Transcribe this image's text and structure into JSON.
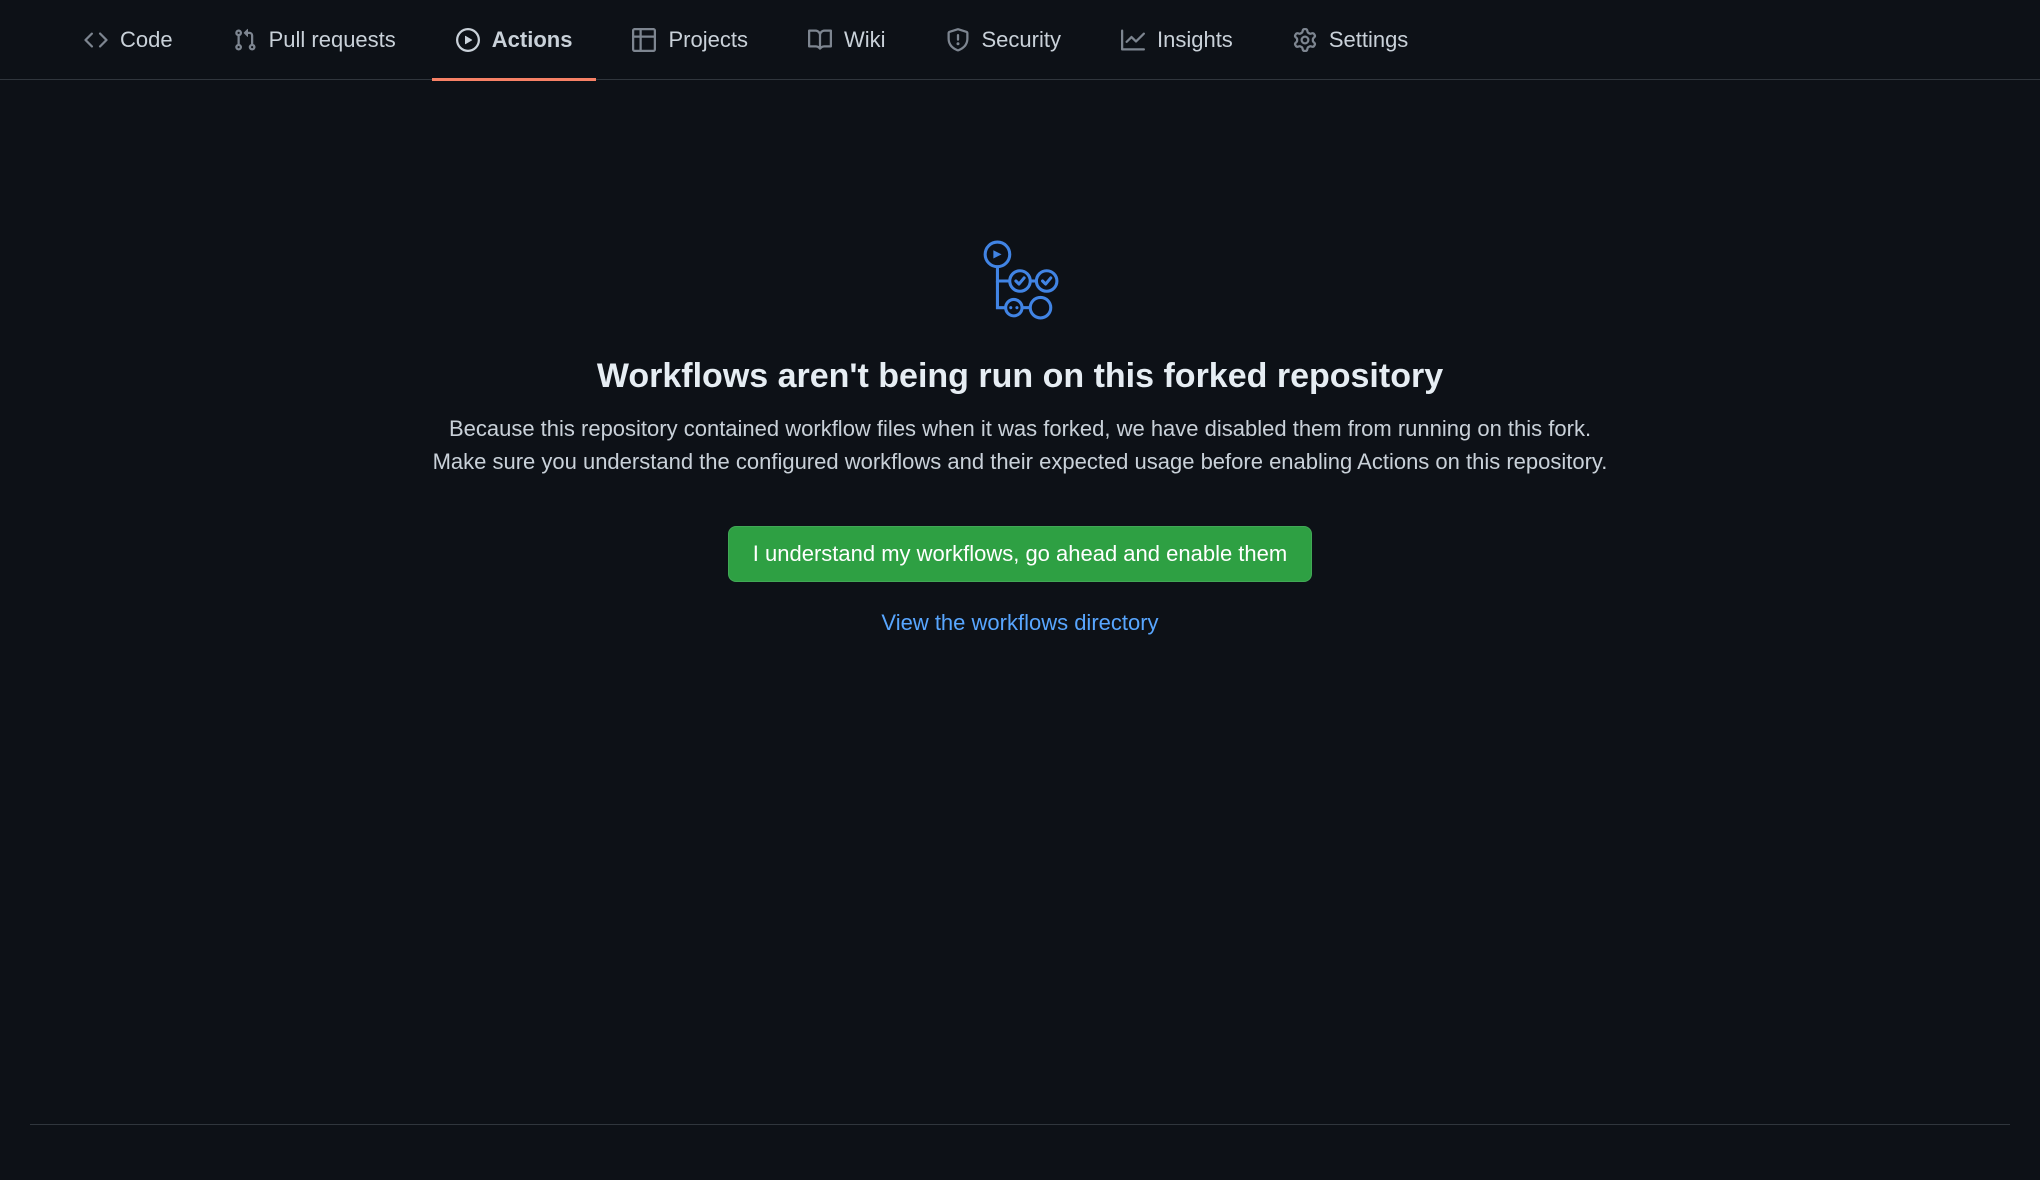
{
  "tabs": {
    "code": "Code",
    "pull_requests": "Pull requests",
    "actions": "Actions",
    "projects": "Projects",
    "wiki": "Wiki",
    "security": "Security",
    "insights": "Insights",
    "settings": "Settings"
  },
  "main": {
    "heading": "Workflows aren't being run on this forked repository",
    "description": "Because this repository contained workflow files when it was forked, we have disabled them from running on this fork. Make sure you understand the configured workflows and their expected usage before enabling Actions on this repository.",
    "enable_button": "I understand my workflows, go ahead and enable them",
    "view_link": "View the workflows directory"
  }
}
